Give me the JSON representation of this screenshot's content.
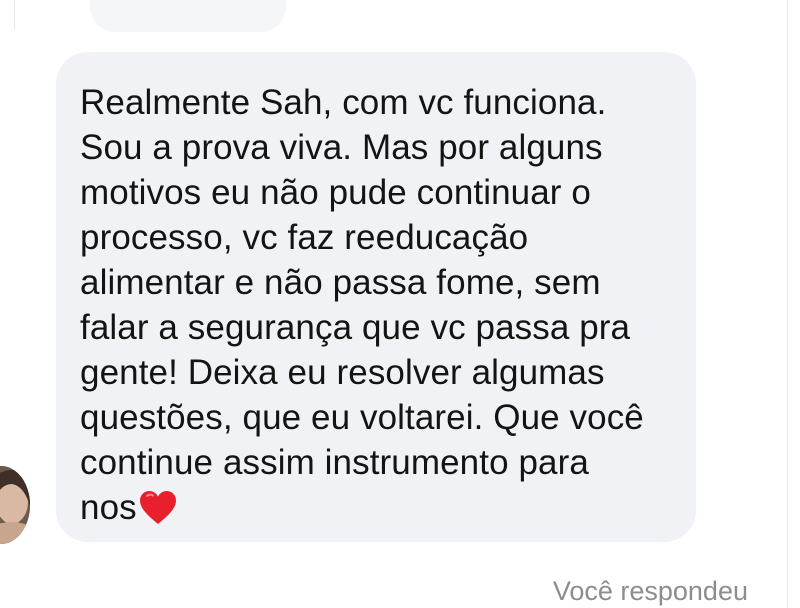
{
  "message": {
    "lines": [
      "Realmente Sah, com vc funciona.",
      "Sou a prova viva. Mas por alguns",
      "motivos eu não pude continuar o",
      "processo, vc faz reeducação",
      "alimentar e não passa fome, sem",
      "falar a segurança que vc passa pra",
      "gente! Deixa eu resolver algumas",
      "questões, que eu voltarei. Que você",
      "continue assim instrumento para",
      "nos"
    ],
    "emoji_icon": "red-heart-icon"
  },
  "status": {
    "reply_text": "Você respondeu"
  },
  "colors": {
    "bubble_bg": "#f0f2f5",
    "text": "#141414",
    "status_text": "#8a8d91",
    "heart": "#e8202d"
  }
}
